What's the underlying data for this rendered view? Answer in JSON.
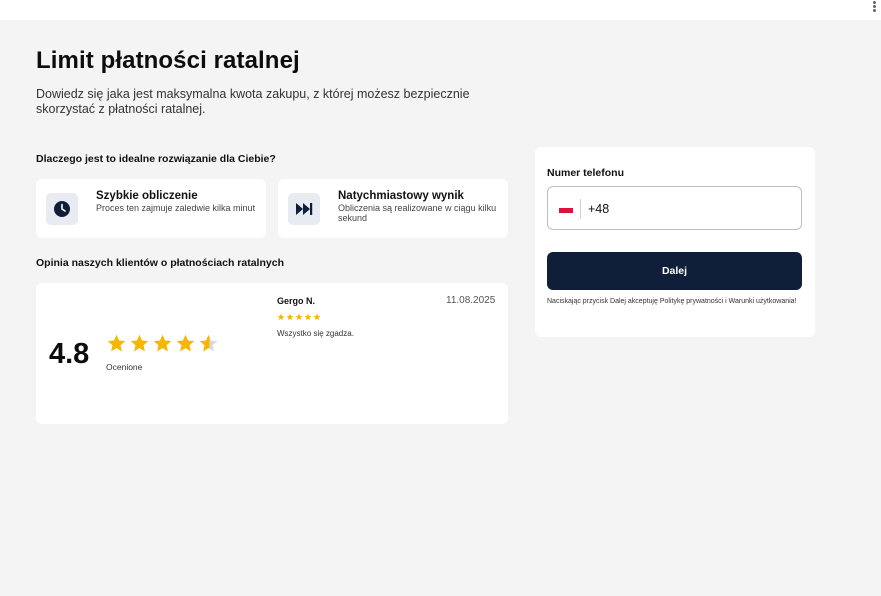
{
  "header": {
    "title": "Limit płatności ratalnej",
    "subtitle": "Dowiedz się jaka jest maksymalna kwota zakupu, z której możesz bezpiecznie skorzystać z płatności ratalnej."
  },
  "why": {
    "title": "Dlaczego jest to idealne rozwiązanie dla Ciebie?",
    "features": [
      {
        "icon": "clock-icon",
        "title": "Szybkie obliczenie",
        "desc": "Proces ten zajmuje zaledwie kilka minut"
      },
      {
        "icon": "fast-forward-icon",
        "title": "Natychmiastowy wynik",
        "desc": "Obliczenia są realizowane w ciągu kilku sekund"
      }
    ]
  },
  "reviews": {
    "title": "Opinia naszych klientów o płatnościach ratalnych",
    "rating": "4.8",
    "rating_value": 4.8,
    "rating_max": 5,
    "rated_label": "Ocenione",
    "review": {
      "name": "Gergo N.",
      "date": "11.08.2025",
      "stars": 5,
      "text": "Wszystko się zgadza."
    }
  },
  "form": {
    "phone_label": "Numer telefonu",
    "phone_value": "+48",
    "submit_label": "Dalej",
    "consent": "Naciskając przycisk Dalej akceptuję Politykę prywatności i Warunki użytkowania!"
  },
  "colors": {
    "accent": "#0f1f3a",
    "star": "#f5b700",
    "background": "#f4f4f4"
  }
}
